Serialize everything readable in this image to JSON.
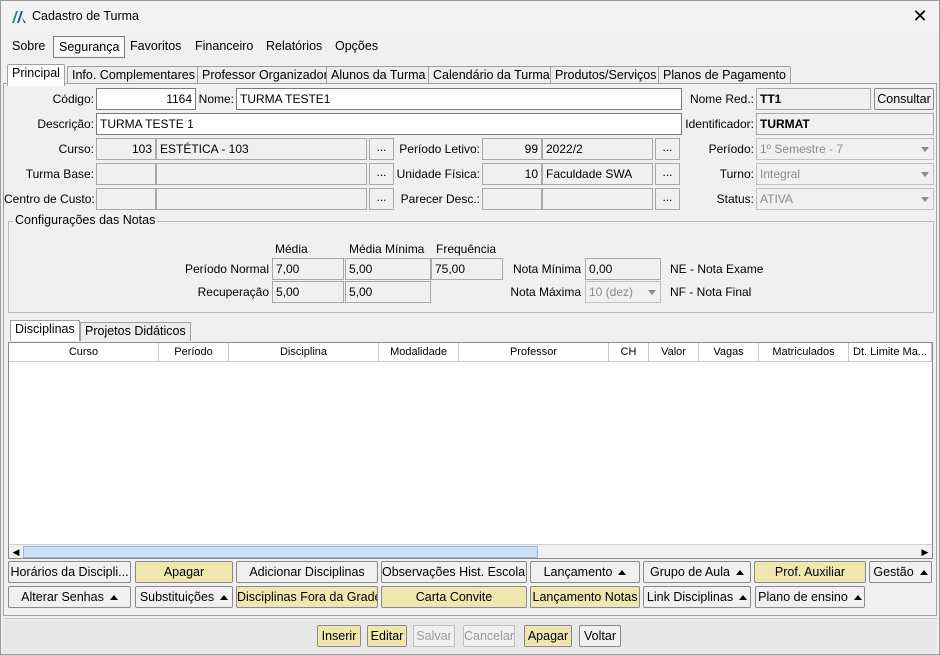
{
  "window": {
    "title": "Cadastro de Turma",
    "close_glyph": "✕"
  },
  "menu": [
    "Sobre",
    "Segurança",
    "Favoritos",
    "Financeiro",
    "Relatórios",
    "Opções"
  ],
  "tabs": [
    "Principal",
    "Info. Complementares",
    "Professor Organizador",
    "Alunos da Turma",
    "Calendário da Turma",
    "Produtos/Serviços",
    "Planos de Pagamento"
  ],
  "form": {
    "codigo_label": "Código:",
    "codigo": "1164",
    "nome_label": "Nome:",
    "nome": "TURMA TESTE1",
    "nome_red_label": "Nome Red.:",
    "nome_red": "TT1",
    "consultar": "Consultar",
    "descricao_label": "Descrição:",
    "descricao": "TURMA TESTE 1",
    "identificador_label": "Identificador:",
    "identificador": "TURMAT",
    "curso_label": "Curso:",
    "curso_code": "103",
    "curso_name": "ESTÉTICA - 103",
    "periodo_letivo_label": "Período Letivo:",
    "periodo_letivo_code": "99",
    "periodo_letivo": "2022/2",
    "periodo_label": "Período:",
    "periodo": "1º Semestre - 7",
    "turma_base_label": "Turma Base:",
    "unidade_fisica_label": "Unidade Física:",
    "unidade_code": "10",
    "unidade": "Faculdade SWA",
    "turno_label": "Turno:",
    "turno": "Integral",
    "centro_custo_label": "Centro de Custo:",
    "parecer_label": "Parecer Desc.:",
    "status_label": "Status:",
    "status": "ATIVA",
    "dots": "..."
  },
  "notas": {
    "title": "Configurações das Notas",
    "col_media": "Média",
    "col_media_min": "Média Mínima",
    "col_frequencia": "Frequência",
    "periodo_normal_label": "Período Normal",
    "pn_media": "7,00",
    "pn_media_min": "5,00",
    "pn_frequencia": "75,00",
    "recuperacao_label": "Recuperação",
    "rec_media": "5,00",
    "rec_media_min": "5,00",
    "nota_minima_label": "Nota Mínima",
    "nota_minima": "0,00",
    "nota_maxima_label": "Nota Máxima",
    "nota_maxima": "10 (dez)",
    "ne": "NE - Nota Exame",
    "nf": "NF - Nota Final"
  },
  "inner_tabs": [
    "Disciplinas",
    "Projetos Didáticos"
  ],
  "grid_columns": [
    "Curso",
    "Período",
    "Disciplina",
    "Modalidade",
    "Professor",
    "CH",
    "Valor",
    "Vagas",
    "Matriculados",
    "Dt. Limite Ma..."
  ],
  "actions_row1": [
    {
      "label": "Horários da Discipli...",
      "style": "normal",
      "menu": false
    },
    {
      "label": "Apagar",
      "style": "yellow",
      "menu": false
    },
    {
      "label": "Adicionar Disciplinas",
      "style": "normal",
      "menu": false
    },
    {
      "label": "Observações Hist. Escolar",
      "style": "normal",
      "menu": false
    },
    {
      "label": "Lançamento",
      "style": "normal",
      "menu": true
    },
    {
      "label": "Grupo de Aula",
      "style": "normal",
      "menu": true
    },
    {
      "label": "Prof. Auxiliar",
      "style": "yellow",
      "menu": false
    },
    {
      "label": "Gestão",
      "style": "normal",
      "menu": true
    }
  ],
  "actions_row2": [
    {
      "label": "Alterar Senhas",
      "style": "normal",
      "menu": true
    },
    {
      "label": "Substituições",
      "style": "normal",
      "menu": true
    },
    {
      "label": "Disciplinas Fora da Grade",
      "style": "yellow",
      "menu": false
    },
    {
      "label": "Carta Convite",
      "style": "yellow",
      "menu": false
    },
    {
      "label": "Lançamento Notas",
      "style": "yellow",
      "menu": false
    },
    {
      "label": "Link Disciplinas",
      "style": "normal",
      "menu": true
    },
    {
      "label": "Plano de ensino",
      "style": "normal",
      "menu": true
    }
  ],
  "bottom": [
    {
      "label": "Inserir",
      "style": "yellow"
    },
    {
      "label": "Editar",
      "style": "yellow"
    },
    {
      "label": "Salvar",
      "style": "disabled"
    },
    {
      "label": "Cancelar",
      "style": "disabled"
    },
    {
      "label": "Apagar",
      "style": "yellow"
    },
    {
      "label": "Voltar",
      "style": "normal"
    }
  ],
  "colors": {
    "accent_yellow": "#f0e6b0",
    "window_bg": "#f0f0f0",
    "scroll_thumb": "#cde3f5"
  }
}
